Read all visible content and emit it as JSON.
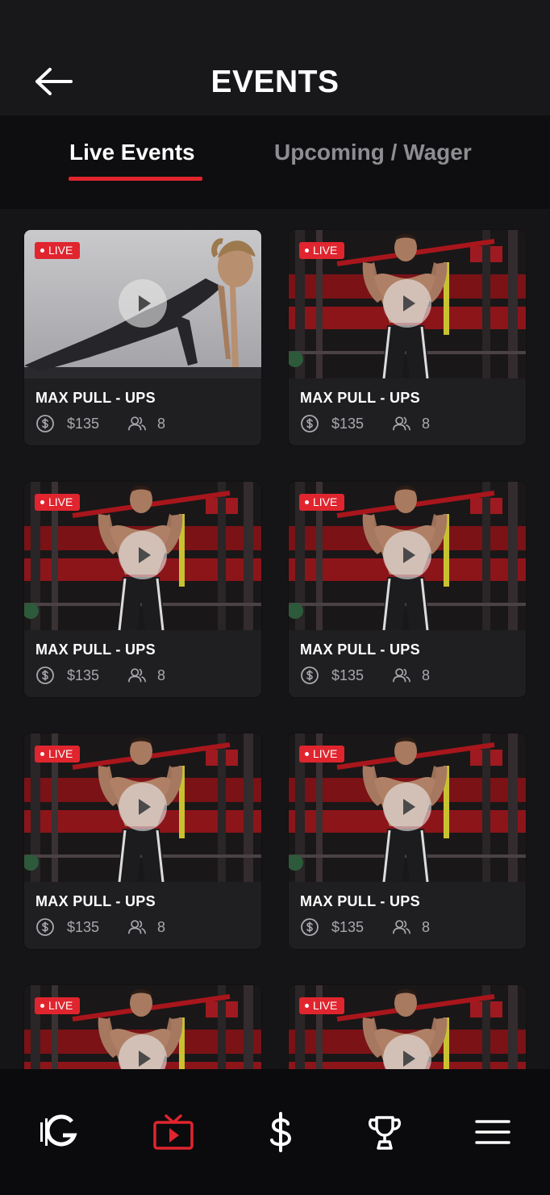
{
  "header": {
    "title": "EVENTS"
  },
  "tabs": {
    "live": "Live Events",
    "upcoming": "Upcoming / Wager"
  },
  "colors": {
    "accent": "#e0252e",
    "background": "#151518",
    "card": "#1f1f22",
    "inactive_tab": "#8d8d92"
  },
  "events": [
    {
      "badge": "LIVE",
      "title": "MAX PULL - UPS",
      "price": "$135",
      "participants": "8",
      "image": "woman-plank"
    },
    {
      "badge": "LIVE",
      "title": "MAX PULL - UPS",
      "price": "$135",
      "participants": "8",
      "image": "man-pullup"
    },
    {
      "badge": "LIVE",
      "title": "MAX PULL - UPS",
      "price": "$135",
      "participants": "8",
      "image": "man-pullup"
    },
    {
      "badge": "LIVE",
      "title": "MAX PULL - UPS",
      "price": "$135",
      "participants": "8",
      "image": "man-pullup"
    },
    {
      "badge": "LIVE",
      "title": "MAX PULL - UPS",
      "price": "$135",
      "participants": "8",
      "image": "man-pullup"
    },
    {
      "badge": "LIVE",
      "title": "MAX PULL - UPS",
      "price": "$135",
      "participants": "8",
      "image": "man-pullup"
    },
    {
      "badge": "LIVE",
      "title": "",
      "price": "",
      "participants": "",
      "image": "man-pullup"
    },
    {
      "badge": "LIVE",
      "title": "",
      "price": "",
      "participants": "",
      "image": "man-pullup"
    }
  ],
  "nav": [
    {
      "icon": "brand-logo-icon",
      "active": false
    },
    {
      "icon": "live-tv-icon",
      "active": true
    },
    {
      "icon": "dollar-icon",
      "active": false
    },
    {
      "icon": "trophy-icon",
      "active": false
    },
    {
      "icon": "menu-icon",
      "active": false
    }
  ]
}
